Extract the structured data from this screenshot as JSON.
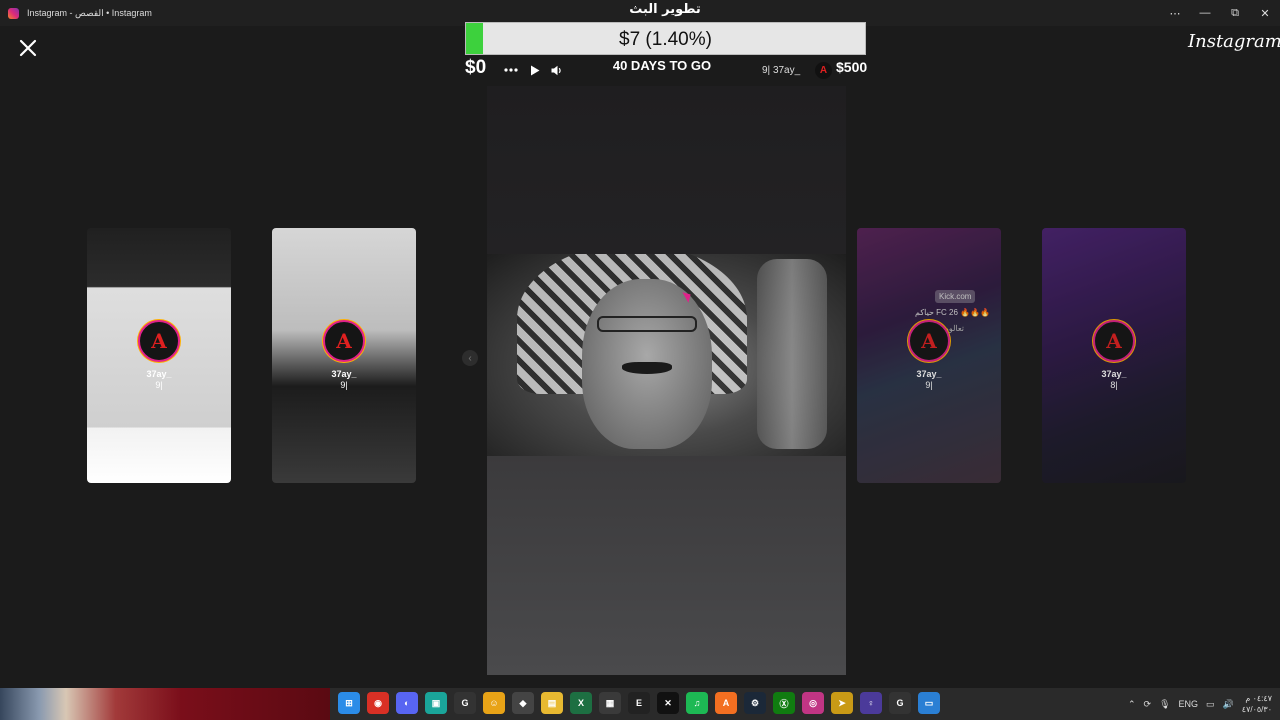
{
  "window": {
    "title": "Instagram - القصص • Instagram",
    "controls": {
      "more": "⋯",
      "minimize": "—",
      "restore": "⧉",
      "close": "✕"
    }
  },
  "overlay": {
    "title": "تطوير البث",
    "progress_label": "$7 (1.40%)",
    "progress_value": 0.014,
    "goal_min": "$0",
    "goal_max": "$500",
    "days_to_go": "40 DAYS TO GO",
    "stream_user": "9| 37ay_",
    "avatar_letter": "A"
  },
  "viewer": {
    "close_icon": "close-icon",
    "logo": "Instagram",
    "cursor_color": "#e0218a",
    "prev_arrow": "‹"
  },
  "stories": [
    {
      "username": "37ay_",
      "count": "9|",
      "avatar_letter": "A"
    },
    {
      "username": "37ay_",
      "count": "9|",
      "avatar_letter": "A"
    },
    {
      "username": "37ay_",
      "count": "9|",
      "avatar_letter": "A",
      "overlay_tag": "Kick.com",
      "overlay_text": "حياكم FC 26 🔥🔥🔥",
      "overlay_text2": "تعالوو"
    },
    {
      "username": "37ay_",
      "count": "8|",
      "avatar_letter": "A"
    }
  ],
  "taskbar": {
    "apps": [
      {
        "name": "start",
        "color": "#2b8ce8",
        "glyph": "⊞"
      },
      {
        "name": "chrome",
        "color": "#d93025",
        "glyph": "◉"
      },
      {
        "name": "discord",
        "color": "#5865f2",
        "glyph": "◐"
      },
      {
        "name": "app-teal",
        "color": "#1aa59a",
        "glyph": "▣"
      },
      {
        "name": "g-app",
        "color": "#333",
        "glyph": "G"
      },
      {
        "name": "app-yellow",
        "color": "#e8a317",
        "glyph": "☺"
      },
      {
        "name": "app-box",
        "color": "#444",
        "glyph": "◆"
      },
      {
        "name": "explorer",
        "color": "#e8b931",
        "glyph": "▤"
      },
      {
        "name": "excel",
        "color": "#1d6f42",
        "glyph": "X"
      },
      {
        "name": "store",
        "color": "#3a3a3a",
        "glyph": "▦"
      },
      {
        "name": "epic",
        "color": "#222",
        "glyph": "E"
      },
      {
        "name": "capcut",
        "color": "#111",
        "glyph": "✕"
      },
      {
        "name": "spotify",
        "color": "#1db954",
        "glyph": "♫"
      },
      {
        "name": "app-orange",
        "color": "#f36f21",
        "glyph": "A"
      },
      {
        "name": "steam",
        "color": "#1b2838",
        "glyph": "⚙"
      },
      {
        "name": "xbox",
        "color": "#107c10",
        "glyph": "Ⓧ"
      },
      {
        "name": "instagram",
        "color": "#c13584",
        "glyph": "◎"
      },
      {
        "name": "app-gold",
        "color": "#c99a16",
        "glyph": "➤"
      },
      {
        "name": "app-purple",
        "color": "#4b3a9a",
        "glyph": "♀"
      },
      {
        "name": "g-app-2",
        "color": "#333",
        "glyph": "G"
      },
      {
        "name": "app-blue",
        "color": "#2a7fd4",
        "glyph": "▭"
      }
    ],
    "tray": {
      "lang": "ENG",
      "time": "٠٤:٤٧ م",
      "date": "٤٧/٠٥/٣٠"
    }
  }
}
